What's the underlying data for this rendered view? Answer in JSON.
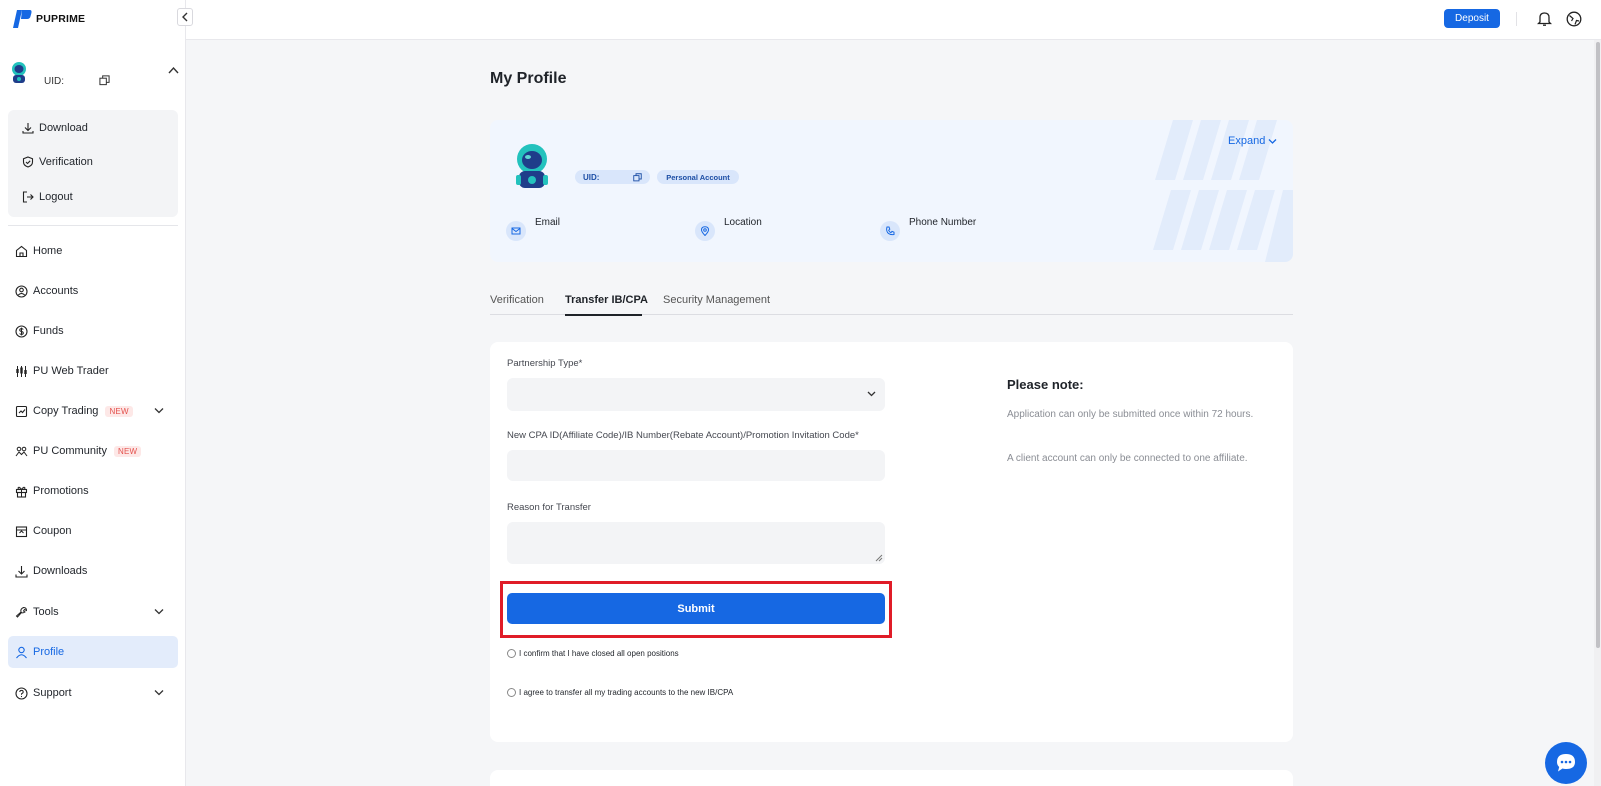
{
  "brand": {
    "name": "PUPRIME",
    "accent": "#1668e3"
  },
  "user": {
    "uid_label": "UID:"
  },
  "user_menu": [
    {
      "label": "Download",
      "icon": "download-icon"
    },
    {
      "label": "Verification",
      "icon": "shield-check-icon"
    },
    {
      "label": "Logout",
      "icon": "logout-icon"
    }
  ],
  "nav": {
    "home": "Home",
    "accounts": "Accounts",
    "funds": "Funds",
    "web_trader": "PU Web Trader",
    "copy_trading": "Copy Trading",
    "community": "PU Community",
    "promotions": "Promotions",
    "coupon": "Coupon",
    "downloads": "Downloads",
    "tools": "Tools",
    "profile": "Profile",
    "support": "Support",
    "new_badge": "NEW"
  },
  "topbar": {
    "deposit_label": "Deposit"
  },
  "page": {
    "title": "My Profile"
  },
  "profile_card": {
    "uid_label": "UID:",
    "account_type": "Personal Account",
    "expand_label": "Expand",
    "email_label": "Email",
    "location_label": "Location",
    "phone_label": "Phone Number"
  },
  "tabs": [
    {
      "label": "Verification",
      "active": false
    },
    {
      "label": "Transfer IB/CPA",
      "active": true
    },
    {
      "label": "Security Management",
      "active": false
    }
  ],
  "form": {
    "partnership_label": "Partnership Type*",
    "cpa_label": "New CPA ID(Affiliate Code)/IB Number(Rebate Account)/Promotion Invitation Code*",
    "reason_label": "Reason for Transfer",
    "submit_label": "Submit",
    "confirm_positions": "I confirm that I have closed all open positions",
    "agree_transfer": "I agree to transfer all my trading accounts to the new IB/CPA"
  },
  "note": {
    "title": "Please note:",
    "p1": "Application can only be submitted once within 72 hours.",
    "p2": "A client account can only be connected to one affiliate."
  }
}
